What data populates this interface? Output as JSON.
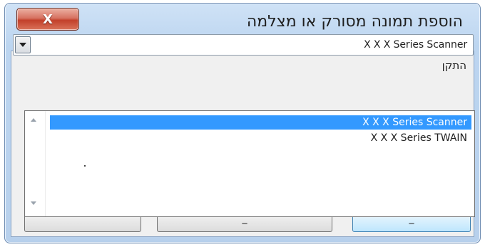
{
  "window": {
    "title": "הוספת תמונה מסורק או מצלמה",
    "close_icon": "x-icon",
    "close_glyph": "X"
  },
  "device": {
    "label": "התקן",
    "selected": "X X X Series Scanner",
    "options": [
      "X X X Series Scanner",
      "X X X  Series TWAIN"
    ]
  },
  "buttons": [
    {
      "label": ""
    },
    {
      "label": "_"
    },
    {
      "label": "_"
    }
  ]
}
